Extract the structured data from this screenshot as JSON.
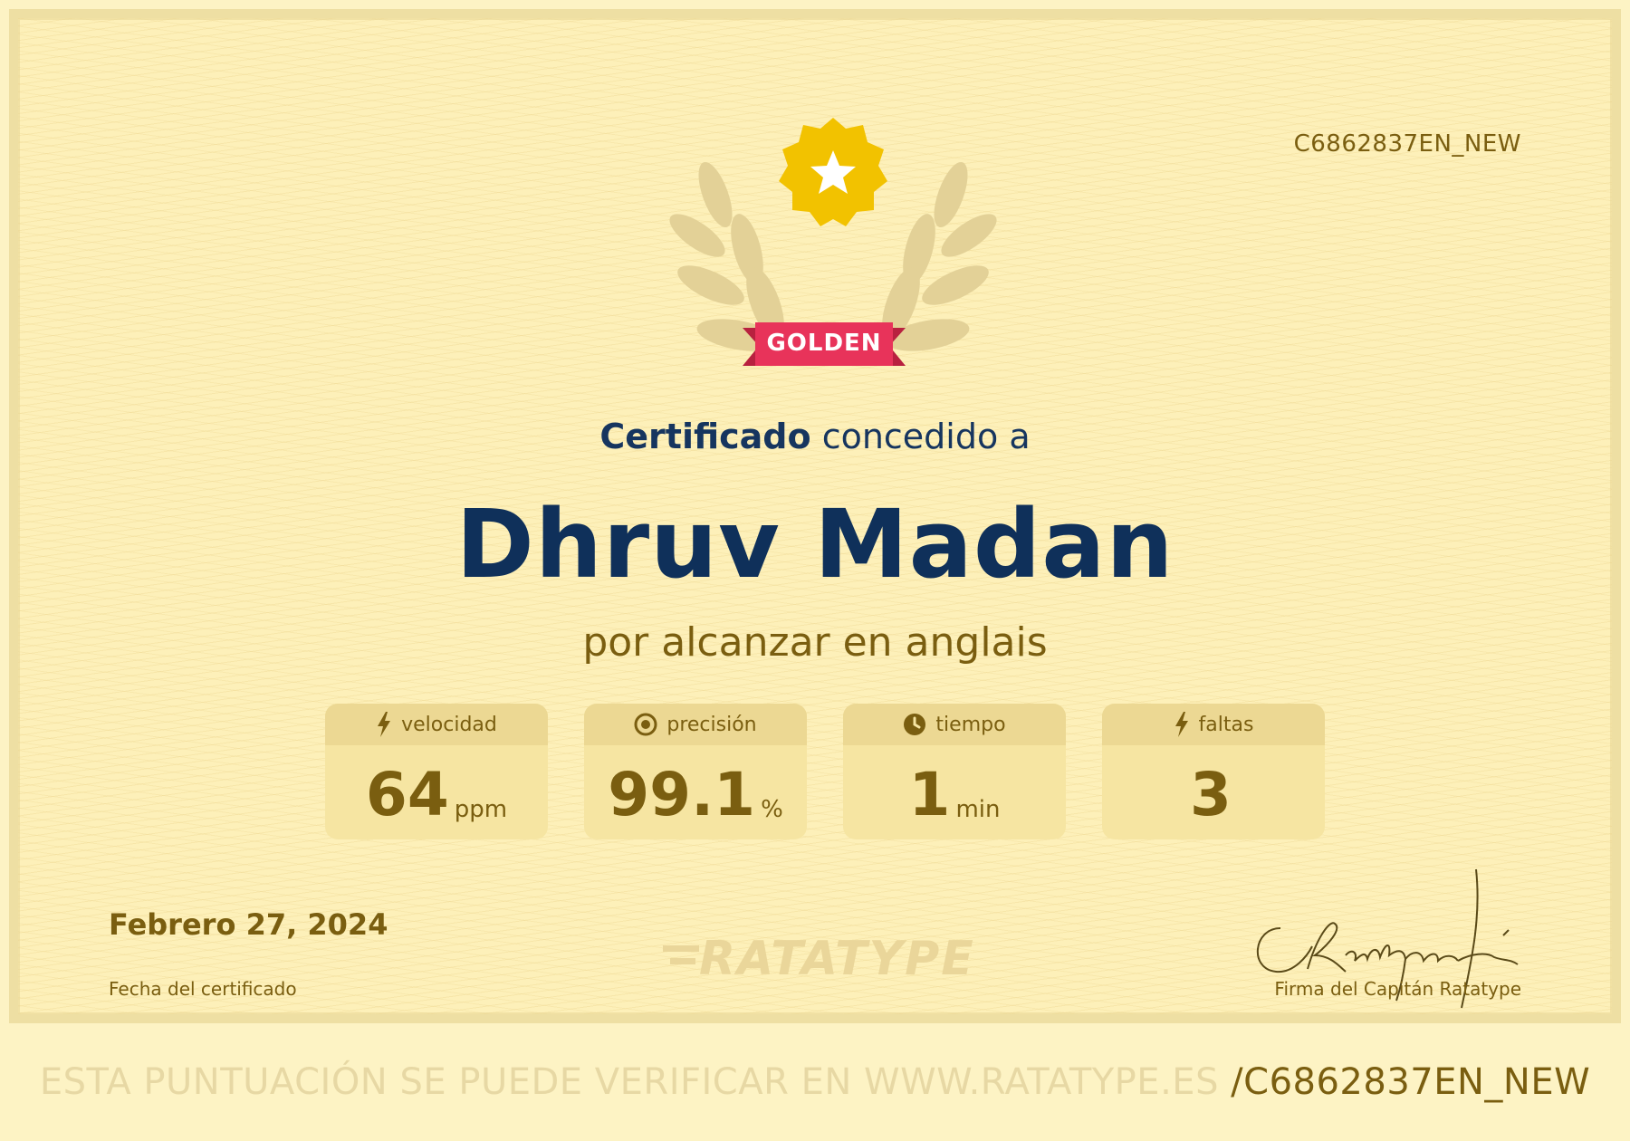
{
  "certificate": {
    "id": "C6862837EN_NEW",
    "badge_label": "GOLDEN",
    "heading_strong": "Certificado",
    "heading_rest": " concedido a",
    "name": "Dhruv Madan",
    "subtitle": "por alcanzar en anglais",
    "date": "Febrero 27, 2024",
    "date_label": "Fecha del certificado",
    "signature_label": "Firma del Capitán Ratatype",
    "logo_text": "RATATYPE"
  },
  "stats": [
    {
      "label": "velocidad",
      "value": "64",
      "unit": "ppm",
      "icon": "bolt-icon"
    },
    {
      "label": "precisión",
      "value": "99.1",
      "unit": "%",
      "icon": "target-icon"
    },
    {
      "label": "tiempo",
      "value": "1",
      "unit": "min",
      "icon": "clock-icon"
    },
    {
      "label": "faltas",
      "value": "3",
      "unit": "",
      "icon": "bolt-icon"
    }
  ],
  "footer": {
    "text": "ESTA PUNTUACIÓN SE PUEDE VERIFICAR EN WWW.RATATYPE.ES",
    "code": "/C6862837EN_NEW"
  },
  "colors": {
    "background": "#fdf0b9",
    "name": "#0f305a",
    "text_brown": "#7a5e10",
    "badge_star": "#f2c200",
    "ribbon": "#e8335a"
  }
}
